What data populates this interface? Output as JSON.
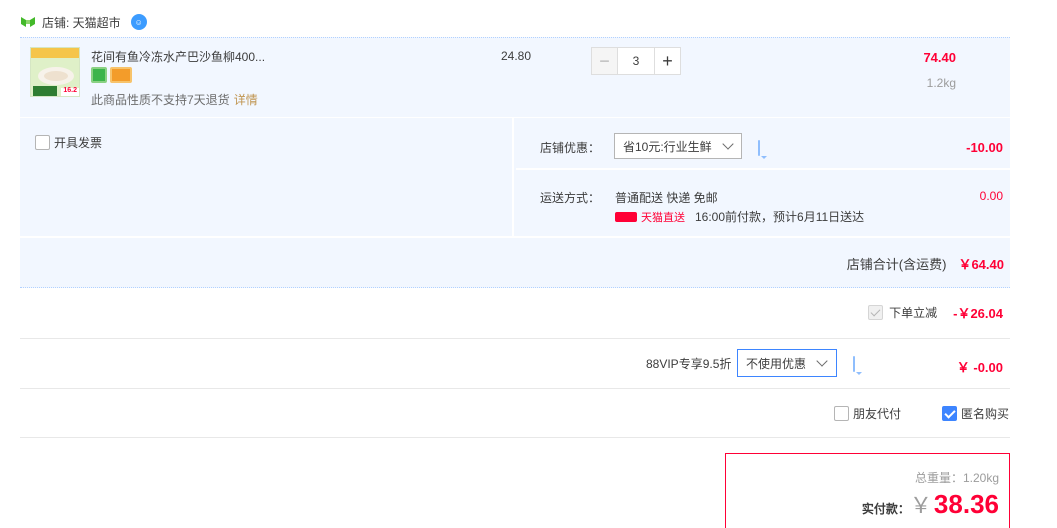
{
  "store": {
    "label": "店铺: 天猫超市"
  },
  "item": {
    "title": "花间有鱼冷冻水产巴沙鱼柳400...",
    "thumb_badge": "16.2",
    "note": "此商品性质不支持7天退货",
    "detail_link": "详情",
    "unit_price": "24.80",
    "quantity": "3",
    "minus": "−",
    "plus": "+",
    "total": "74.40",
    "weight": "1.2kg"
  },
  "invoice": {
    "label": "开具发票"
  },
  "store_discount": {
    "label": "店铺优惠：",
    "selected": "省10元:行业生鲜",
    "amount": "-10.00"
  },
  "shipping": {
    "label": "运送方式：",
    "method": "普通配送 快递 免邮",
    "brand": "天猫直送",
    "eta": "16:00前付款，预计6月11日送达",
    "amount": "0.00"
  },
  "store_total": {
    "label": "店铺合计(含运费)",
    "amount": "￥64.40"
  },
  "instant_discount": {
    "label": "下单立减",
    "amount": "-￥26.04"
  },
  "vip": {
    "label": "88VIP专享9.5折",
    "selected": "不使用优惠",
    "amount": "￥ -0.00"
  },
  "options": {
    "friend_pay": "朋友代付",
    "anonymous": "匿名购买"
  },
  "pay": {
    "weight_label": "总重量：1.20kg",
    "actual_label": "实付款：",
    "currency": "￥",
    "amount": "38.36"
  },
  "colors": {
    "accent": "#ff0036",
    "panel": "#f2f7ff",
    "link": "#3d85ff"
  }
}
